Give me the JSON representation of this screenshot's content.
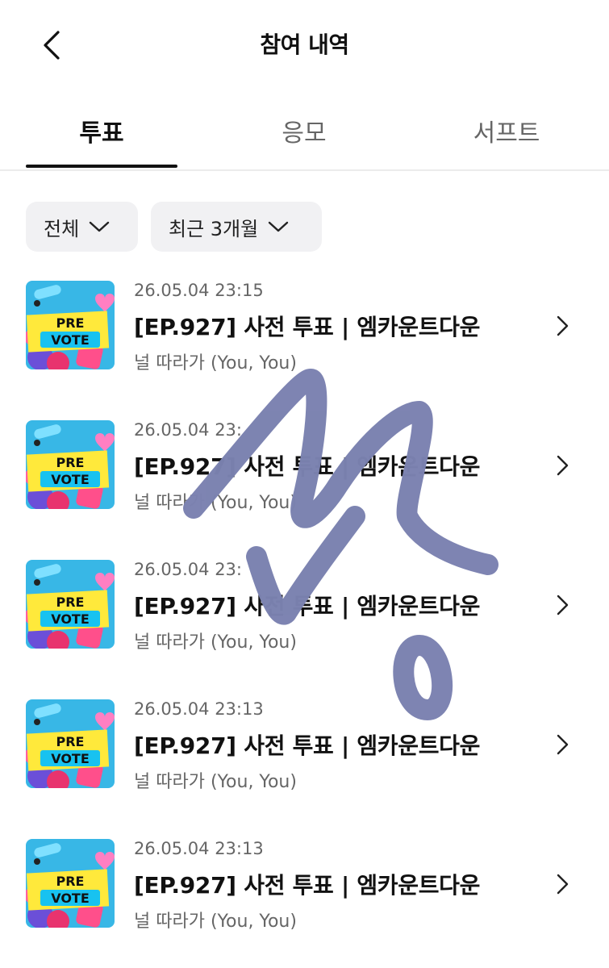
{
  "header": {
    "title": "참여 내역"
  },
  "tabs": [
    {
      "label": "투표",
      "active": true
    },
    {
      "label": "응모",
      "active": false
    },
    {
      "label": "서프트",
      "active": false
    }
  ],
  "filters": {
    "category": "전체",
    "period": "최근 3개월"
  },
  "thumbnail": {
    "line1": "PRE",
    "line2": "VOTE"
  },
  "items": [
    {
      "date": "26.05.04 23:15",
      "name": "[EP.927] 사전 투표 | 엠카운트다운",
      "sub": "널 따라가 (You, You)"
    },
    {
      "date": "26.05.04 23:",
      "name": "[EP.927] 사전 투표 | 엠카운트다운",
      "sub": "널 따라가 (You, You)"
    },
    {
      "date": "26.05.04 23:",
      "name": "[EP.927] 사전 투표 | 엠카운트다운",
      "sub": "널 따라가 (You, You)"
    },
    {
      "date": "26.05.04 23:13",
      "name": "[EP.927] 사전 투표 | 엠카운트다운",
      "sub": "널 따라가 (You, You)"
    },
    {
      "date": "26.05.04 23:13",
      "name": "[EP.927] 사전 투표 | 엠카운트다운",
      "sub": "널 따라가 (You, You)"
    }
  ],
  "colors": {
    "scribble": "#7b82b0",
    "thumb_bg": "#38b7e6",
    "thumb_band": "#ffe93b"
  }
}
